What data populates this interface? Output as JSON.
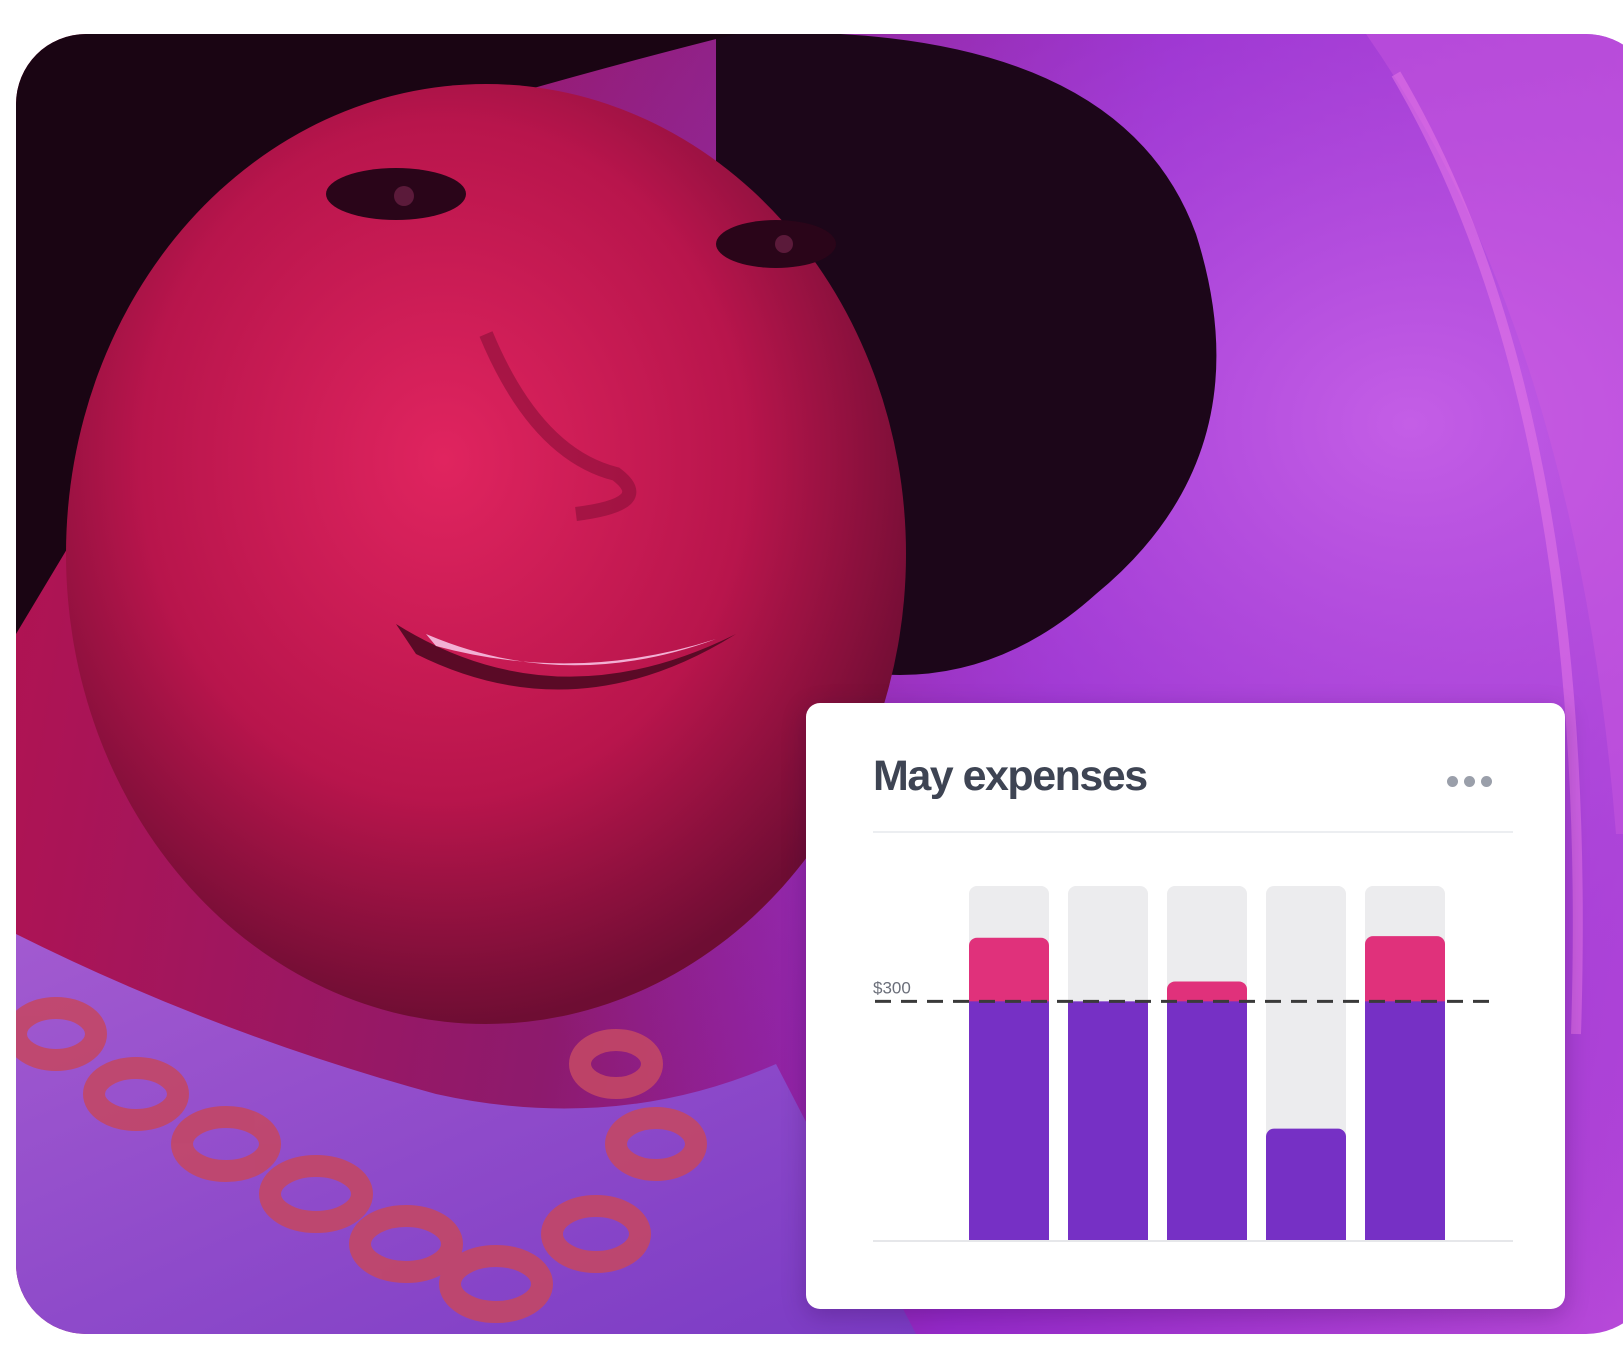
{
  "colors": {
    "card_bg": "#ffffff",
    "title_text": "#3e4453",
    "bar_track": "#ececee",
    "bar_within_budget": "#7630c5",
    "bar_over_budget": "#e0317b",
    "threshold_line": "#3a3a3a",
    "menu_dots": "#9a9faa"
  },
  "card": {
    "title": "May expenses",
    "menu_icon": "more-horizontal-icon"
  },
  "chart_data": {
    "type": "bar",
    "title": "May expenses",
    "categories": [
      "",
      "",
      "",
      "",
      ""
    ],
    "values": [
      380,
      300,
      325,
      140,
      382
    ],
    "ylim": [
      0,
      445
    ],
    "threshold": {
      "label": "$300",
      "value": 300
    },
    "grid": false,
    "legend": "none"
  },
  "background": {
    "subject": "smiling woman under magenta and purple light"
  }
}
